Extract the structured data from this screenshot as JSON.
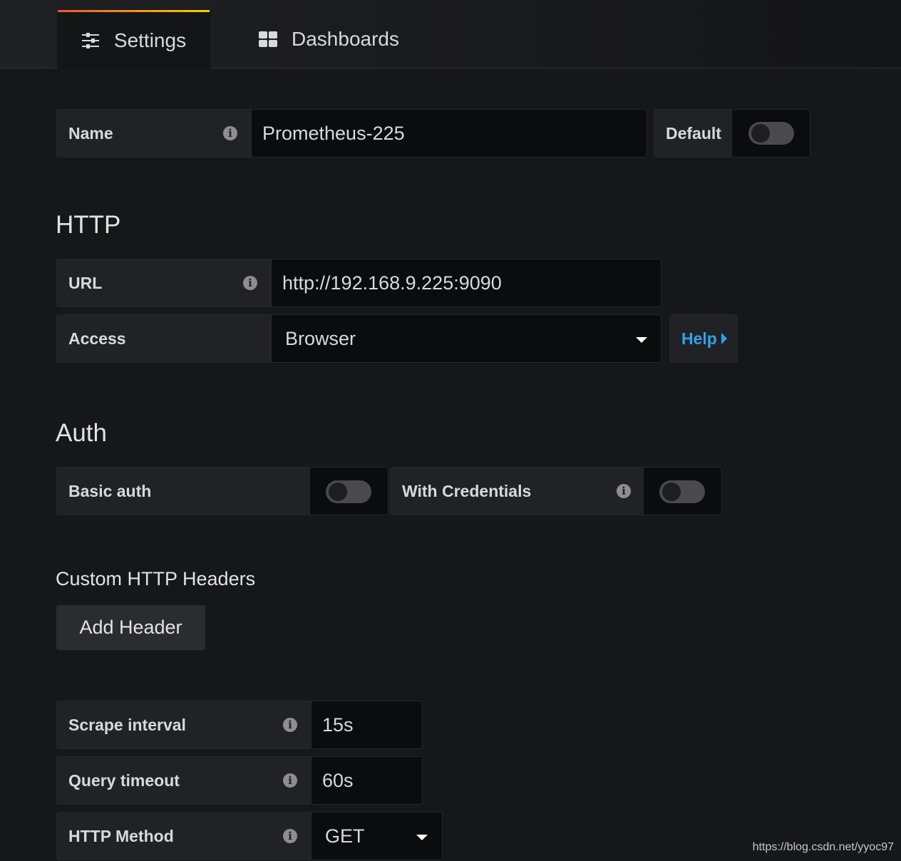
{
  "tabs": [
    {
      "label": "Settings",
      "icon": "sliders-icon",
      "active": true
    },
    {
      "label": "Dashboards",
      "icon": "grid-icon",
      "active": false
    }
  ],
  "name": {
    "label": "Name",
    "value": "Prometheus-225",
    "default_label": "Default",
    "default_on": false
  },
  "http": {
    "heading": "HTTP",
    "url_label": "URL",
    "url_value": "http://192.168.9.225:9090",
    "access_label": "Access",
    "access_value": "Browser",
    "help_label": "Help"
  },
  "auth": {
    "heading": "Auth",
    "basic_label": "Basic auth",
    "basic_on": false,
    "credentials_label": "With Credentials",
    "credentials_on": false
  },
  "headers": {
    "heading": "Custom HTTP Headers",
    "add_label": "Add Header"
  },
  "prom": {
    "scrape_label": "Scrape interval",
    "scrape_value": "15s",
    "timeout_label": "Query timeout",
    "timeout_value": "60s",
    "method_label": "HTTP Method",
    "method_value": "GET"
  },
  "watermark": "https://blog.csdn.net/yyoc97",
  "colors": {
    "accent_link": "#33a2e5",
    "tab_gradient_start": "#eb5a2e",
    "tab_gradient_end": "#fbca0a"
  }
}
